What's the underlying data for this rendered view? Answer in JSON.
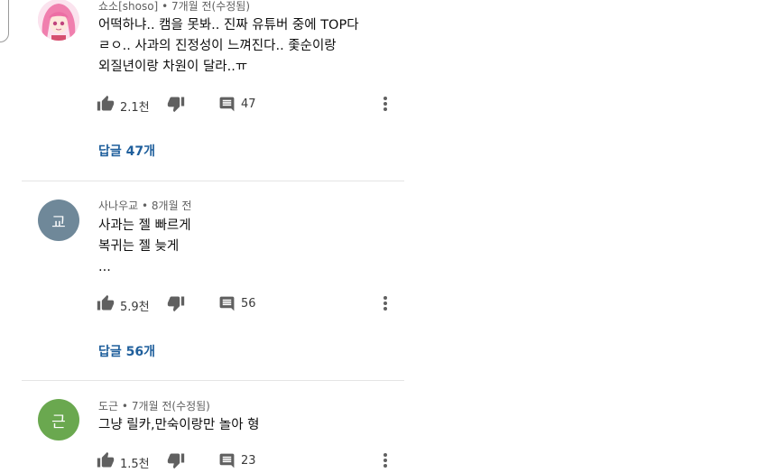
{
  "comments": [
    {
      "author": "쇼소[shoso]",
      "time": "7개월 전(수정됨)",
      "lines": [
        "어떡하냐.. 캠을 못봐.. 진짜 유튜버 중에 TOP다",
        "ㄹㅇ.. 사과의 진정성이 느껴진다.. 좇순이랑",
        "외질년이랑 차원이 달라..ㅠ"
      ],
      "likes": "2.1천",
      "replies": "47",
      "replies_link": "답글 47개"
    },
    {
      "avatar_letter": "교",
      "avatar_color": "#6f8899",
      "author": "사나우교",
      "time": "8개월 전",
      "lines": [
        "사과는 젤 빠르게",
        "복귀는 젤 늦게",
        "..."
      ],
      "likes": "5.9천",
      "replies": "56",
      "replies_link": "답글 56개"
    },
    {
      "avatar_letter": "근",
      "avatar_color": "#6aa84f",
      "author": "도근",
      "time": "7개월 전(수정됨)",
      "lines": [
        "그냥 릴카,만숙이랑만 놀아 형"
      ],
      "likes": "1.5천",
      "replies": "23"
    }
  ],
  "separator": " • ",
  "icons": {
    "like": "thumbs-up-icon",
    "dislike": "thumbs-down-icon",
    "reply": "comment-icon",
    "more": "more-vertical-icon"
  }
}
